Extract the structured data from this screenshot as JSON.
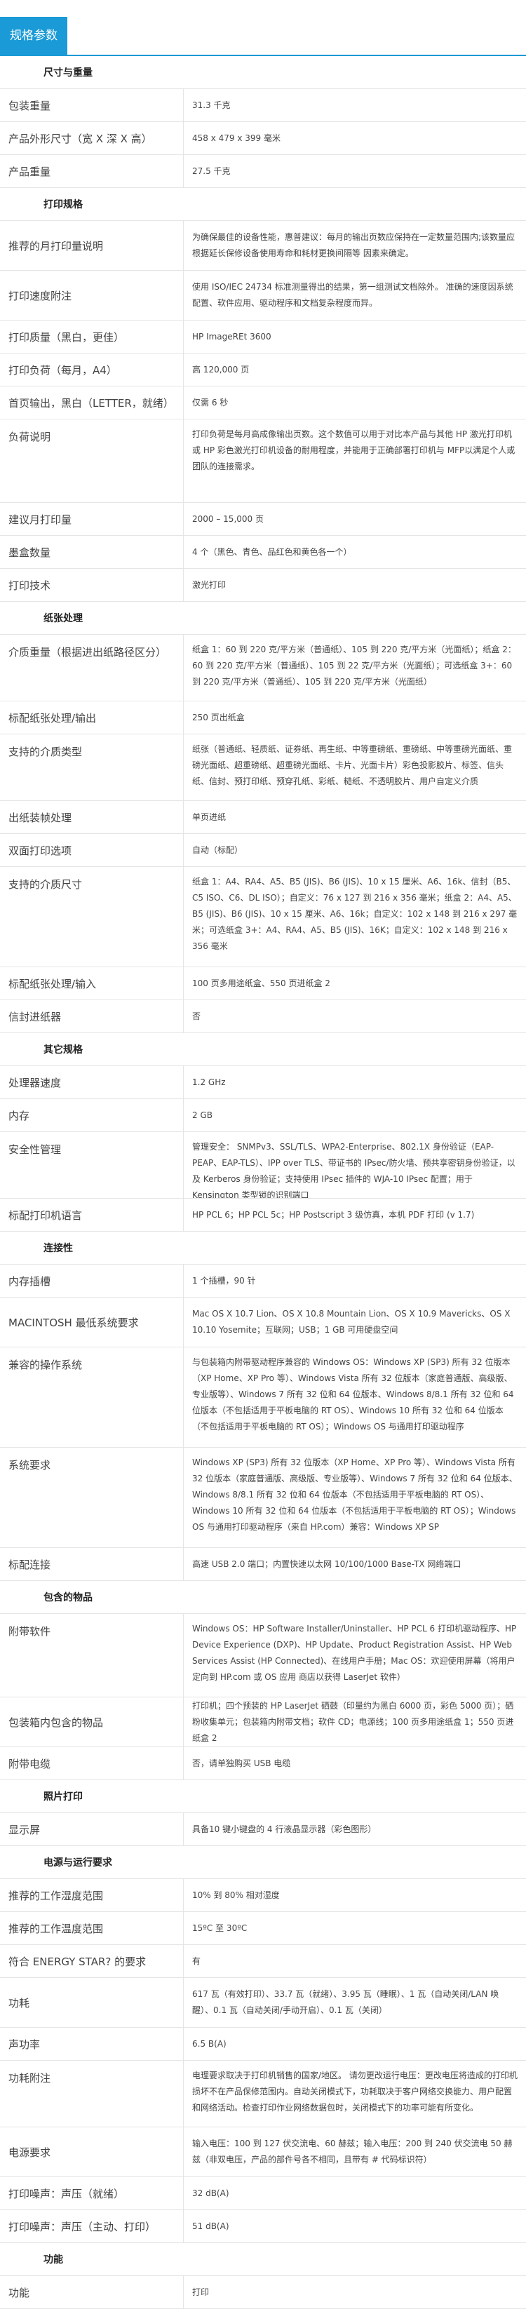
{
  "header": {
    "tab": "规格参数"
  },
  "sections": [
    {
      "title": "尺寸与重量",
      "h": 46,
      "rows": [
        {
          "label": "包装重量",
          "value": "31.3 千克",
          "h": 46
        },
        {
          "label": "产品外形尺寸（宽 X 深 X 高）",
          "value": "458 x 479 x 399 毫米",
          "h": 46
        },
        {
          "label": "产品重量",
          "value": "27.5 千克",
          "h": 46
        }
      ]
    },
    {
      "title": "打印规格",
      "h": 46,
      "rows": [
        {
          "label": "推荐的月打印量说明",
          "value": "为确保最佳的设备性能，惠普建议：每月的输出页数应保持在一定数量范围内;该数量应根据延长保修设备使用寿命和耗材更换间隔等 因素来确定。",
          "h": 70
        },
        {
          "label": "打印速度附注",
          "value": "使用 ISO/IEC 24734 标准测量得出的结果，第一组测试文档除外。 准确的速度因系统配置、软件应用、驱动程序和文档复杂程度而异。",
          "h": 70
        },
        {
          "label": "打印质量（黑白，更佳）",
          "value": "HP ImageREt 3600",
          "h": 46
        },
        {
          "label": "打印负荷（每月，A4）",
          "value": "高 120,000 页",
          "h": 46
        },
        {
          "label": "首页输出，黑白（LETTER，就绪）",
          "value": "仅需 6 秒",
          "h": 46
        },
        {
          "label": "负荷说明",
          "value": "打印负荷是每月高成像输出页数。这个数值可以用于对比本产品与其他 HP 激光打印机 或 HP 彩色激光打印机设备的耐用程度，并能用于正确部署打印机与 MFP以满足个人或团队的连接需求。",
          "h": 118,
          "top": true
        },
        {
          "label": "建议月打印量",
          "value": "2000 – 15,000 页",
          "h": 46
        },
        {
          "label": "墨盒数量",
          "value": "4 个（黑色、青色、品红色和黄色各一个）",
          "h": 46
        },
        {
          "label": "打印技术",
          "value": "激光打印",
          "h": 46
        }
      ]
    },
    {
      "title": "纸张处理",
      "h": 46,
      "rows": [
        {
          "label": "介质重量（根据进出纸路径区分）",
          "value": "纸盒 1：60 到 220 克/平方米（普通纸）、105 到 220 克/平方米（光面纸）；纸盒 2：60 到 220 克/平方米（普通纸）、105 到 22 克/平方米（光面纸）；可选纸盒 3+：60 到 220 克/平方米（普通纸）、105 到 220 克/平方米（光面纸）",
          "h": 94,
          "top": true
        },
        {
          "label": "标配纸张处理/输出",
          "value": "250 页出纸盒",
          "h": 46
        },
        {
          "label": "支持的介质类型",
          "value": "纸张（普通纸、轻质纸、证券纸、再生纸、中等重磅纸、重磅纸、中等重磅光面纸、重磅光面纸、超重磅纸、超重磅光面纸、卡片、光面卡片）彩色投影胶片、标签、信头纸、信封、预打印纸、预穿孔纸、彩纸、糙纸、不透明胶片、用户自定义介质",
          "h": 94,
          "top": true
        },
        {
          "label": "出纸装帧处理",
          "value": "单页进纸",
          "h": 46
        },
        {
          "label": "双面打印选项",
          "value": "自动（标配）",
          "h": 46
        },
        {
          "label": "支持的介质尺寸",
          "value": "纸盒 1：A4、RA4、A5、B5 (JIS)、B6 (JIS)、10 x 15 厘米、A6、16k、信封（B5、C5 ISO、C6、DL ISO）；自定义：76 x 127 到 216 x 356 毫米；纸盒 2：A4、A5、B5 (JIS)、B6 (JIS)、10 x 15 厘米、A6、16k；自定义：102 x 148 到 216 x 297 毫米；可选纸盒 3+：A4、RA4、A5、B5 (JIS)、16K；自定义：102 x 148 到 216 x 356 毫米",
          "h": 142,
          "top": true
        },
        {
          "label": "标配纸张处理/输入",
          "value": "100 页多用途纸盒、550 页进纸盒 2",
          "h": 46
        },
        {
          "label": "信封进纸器",
          "value": "否",
          "h": 46
        }
      ]
    },
    {
      "title": "其它规格",
      "h": 46,
      "rows": [
        {
          "label": "处理器速度",
          "value": "1.2 GHz",
          "h": 46
        },
        {
          "label": "内存",
          "value": "2 GB",
          "h": 46
        },
        {
          "label": "安全性管理",
          "value": "管理安全： SNMPv3、SSL/TLS、WPA2-Enterprise、802.1X 身份验证（EAP-PEAP、EAP-TLS）、IPP over TLS、带证书的 IPsec/防火墙、预共享密钥身份验证，以及 Kerberos 身份验证；支持使用 IPsec 插件的 WJA-10 IPsec 配置；用于 Kensington 类型锁的识别端口",
          "h": 94,
          "top": true
        },
        {
          "label": "标配打印机语言",
          "value": "HP PCL 6；HP PCL 5c；HP Postscript 3 级仿真，本机 PDF 打印 (v 1.7)",
          "h": 46
        }
      ]
    },
    {
      "title": "连接性",
      "h": 46,
      "rows": [
        {
          "label": "内存插槽",
          "value": "1 个插槽，90 针",
          "h": 46
        },
        {
          "label": "MACINTOSH 最低系统要求",
          "value": "Mac OS X 10.7 Lion、OS X 10.8 Mountain Lion、OS X 10.9 Mavericks、OS X 10.10 Yosemite；互联网；USB；1 GB 可用硬盘空间",
          "h": 70
        },
        {
          "label": "兼容的操作系统",
          "value": "与包装箱内附带驱动程序兼容的 Windows OS：Windows XP (SP3) 所有 32 位版本（XP Home、XP Pro 等）、Windows Vista 所有 32 位版本（家庭普通版、高级版、专业版等）、Windows 7 所有 32 位和 64 位版本、Windows 8/8.1 所有 32 位和 64 位版本（不包括适用于平板电脑的 RT OS）、Windows 10 所有 32 位和 64 位版本（不包括适用于平板电脑的 RT OS）；Windows OS 与通用打印驱动程序",
          "h": 142,
          "top": true
        },
        {
          "label": "系统要求",
          "value": "Windows XP (SP3) 所有 32 位版本（XP Home、XP Pro 等）、Windows Vista 所有 32 位版本（家庭普通版、高级版、专业版等）、Windows 7 所有 32 位和 64 位版本、Windows 8/8.1 所有 32 位和 64 位版本（不包括适用于平板电脑的 RT OS）、Windows 10 所有 32 位和 64 位版本（不包括适用于平板电脑的 RT OS）；Windows OS 与通用打印驱动程序（来自 HP.com）兼容：Windows XP SP",
          "h": 142,
          "top": true
        },
        {
          "label": "标配连接",
          "value": "高速 USB 2.0 端口；内置快速以太网 10/100/1000 Base-TX 网络端口",
          "h": 46
        }
      ]
    },
    {
      "title": "包含的物品",
      "h": 46,
      "rows": [
        {
          "label": "附带软件",
          "value": "Windows OS：HP Software Installer/Uninstaller、HP PCL 6 打印机驱动程序、HP Device Experience (DXP)、HP Update、Product Registration Assist、HP Web Services Assist (HP Connected)、在线用户手册；Mac OS：欢迎使用屏幕（将用户定向到 HP.com 或 OS 应用 商店以获得 LaserJet 软件）",
          "h": 118,
          "top": true
        },
        {
          "label": "包装箱内包含的物品",
          "value": "打印机；四个预装的 HP LaserJet 硒鼓（印量约为黑白 6000 页，彩色 5000 页）；硒粉收集单元；包装箱内附带文档；软件 CD；电源线；100 页多用途纸盒 1；550 页进纸盒 2",
          "h": 70
        },
        {
          "label": "附带电缆",
          "value": "否，请单独购买 USB 电缆",
          "h": 46
        }
      ]
    },
    {
      "title": "照片打印",
      "h": 46,
      "rows": [
        {
          "label": "显示屏",
          "value": "具备10 键小键盘的 4 行液晶显示器（彩色图形）",
          "h": 46
        }
      ]
    },
    {
      "title": "电源与运行要求",
      "h": 46,
      "rows": [
        {
          "label": "推荐的工作湿度范围",
          "value": "10% 到 80% 相对湿度",
          "h": 46
        },
        {
          "label": "推荐的工作温度范围",
          "value": "15ºC 至 30ºC",
          "h": 46
        },
        {
          "label": "符合 ENERGY STAR? 的要求",
          "value": "有",
          "h": 46
        },
        {
          "label": "功耗",
          "value": "617 瓦（有效打印）、33.7 瓦（就绪）、3.95 瓦（睡眠）、1 瓦（自动关闭/LAN 唤醒）、0.1 瓦（自动关闭/手动开启）、0.1 瓦（关闭）",
          "h": 70
        },
        {
          "label": "声功率",
          "value": "6.5 B(A)",
          "h": 46
        },
        {
          "label": "功耗附注",
          "value": "电理要求取决于打印机销售的国家/地区。 请勿更改运行电压：更改电压将造成的打印机损坏不在产品保修范围内。自动关闭模式下，功耗取决于客户网络交换能力、用户配置和网络活动。检查打印作业网络数据包时，关闭模式下的功率可能有所变化。",
          "h": 94,
          "top": true
        },
        {
          "label": "电源要求",
          "value": "输入电压：100 到 127 伏交流电、60 赫兹；输入电压：200 到 240 伏交流电 50 赫兹（非双电压，产品的部件号各不相同，且带有 # 代码标识符）",
          "h": 70
        },
        {
          "label": "打印噪声：声压（就绪）",
          "value": "32 dB(A)",
          "h": 46
        },
        {
          "label": "打印噪声：声压（主动、打印）",
          "value": "51 dB(A)",
          "h": 46
        }
      ]
    },
    {
      "title": "功能",
      "h": 46,
      "rows": [
        {
          "label": "功能",
          "value": "打印",
          "h": 46
        }
      ]
    }
  ]
}
